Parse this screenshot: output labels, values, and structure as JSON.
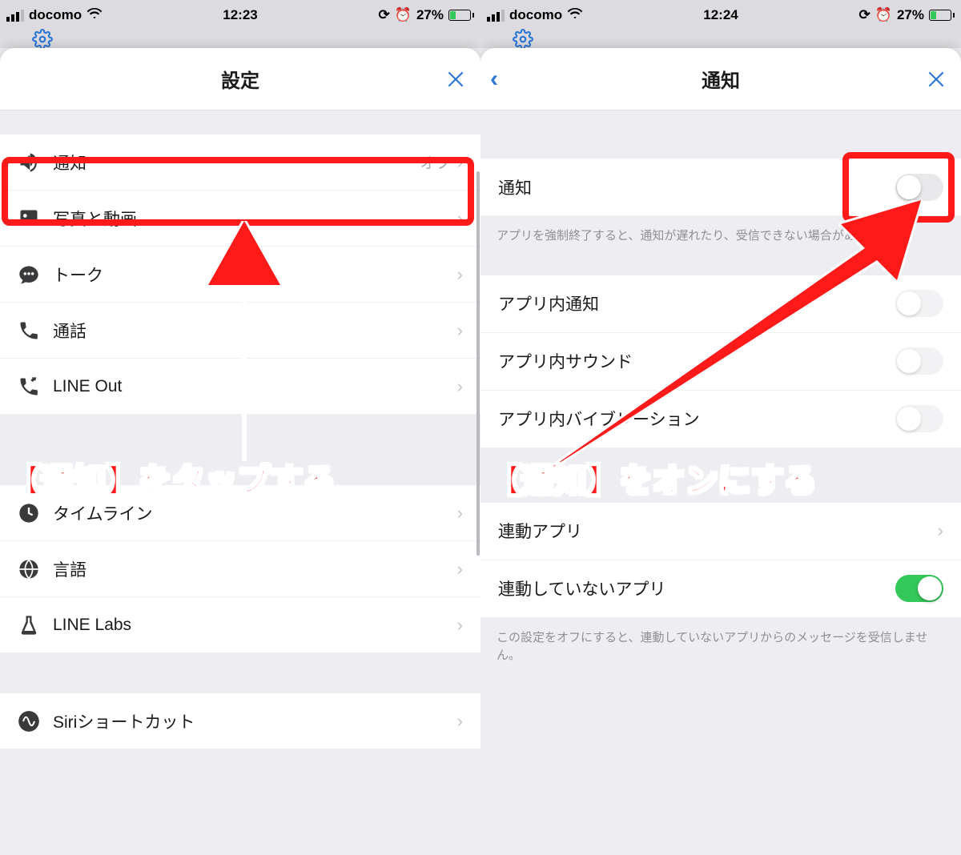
{
  "left": {
    "status": {
      "carrier": "docomo",
      "time": "12:23",
      "battery_pct": "27%"
    },
    "sheet_title": "設定",
    "rows": {
      "notifications": {
        "label": "通知",
        "status": "オフ"
      },
      "photos": {
        "label": "写真と動画"
      },
      "talk": {
        "label": "トーク"
      },
      "calls": {
        "label": "通話"
      },
      "line_out": {
        "label": "LINE Out"
      },
      "timeline": {
        "label": "タイムライン"
      },
      "language": {
        "label": "言語"
      },
      "labs": {
        "label": "LINE Labs"
      },
      "siri": {
        "label": "Siriショートカット"
      }
    },
    "annotation": "【通知】をタップする"
  },
  "right": {
    "status": {
      "carrier": "docomo",
      "time": "12:24",
      "battery_pct": "27%"
    },
    "sheet_title": "通知",
    "rows": {
      "master": {
        "label": "通知"
      },
      "note1": "アプリを強制終了すると、通知が遅れたり、受信できない場合があります。",
      "in_app_notif": {
        "label": "アプリ内通知"
      },
      "in_app_sound": {
        "label": "アプリ内サウンド"
      },
      "in_app_vib": {
        "label": "アプリ内バイブレーション"
      },
      "linked_apps": {
        "label": "連動アプリ"
      },
      "unlinked_apps": {
        "label": "連動していないアプリ"
      },
      "note2": "この設定をオフにすると、連動していないアプリからのメッセージを受信しません。"
    },
    "annotation": "【通知】をオンにする"
  }
}
